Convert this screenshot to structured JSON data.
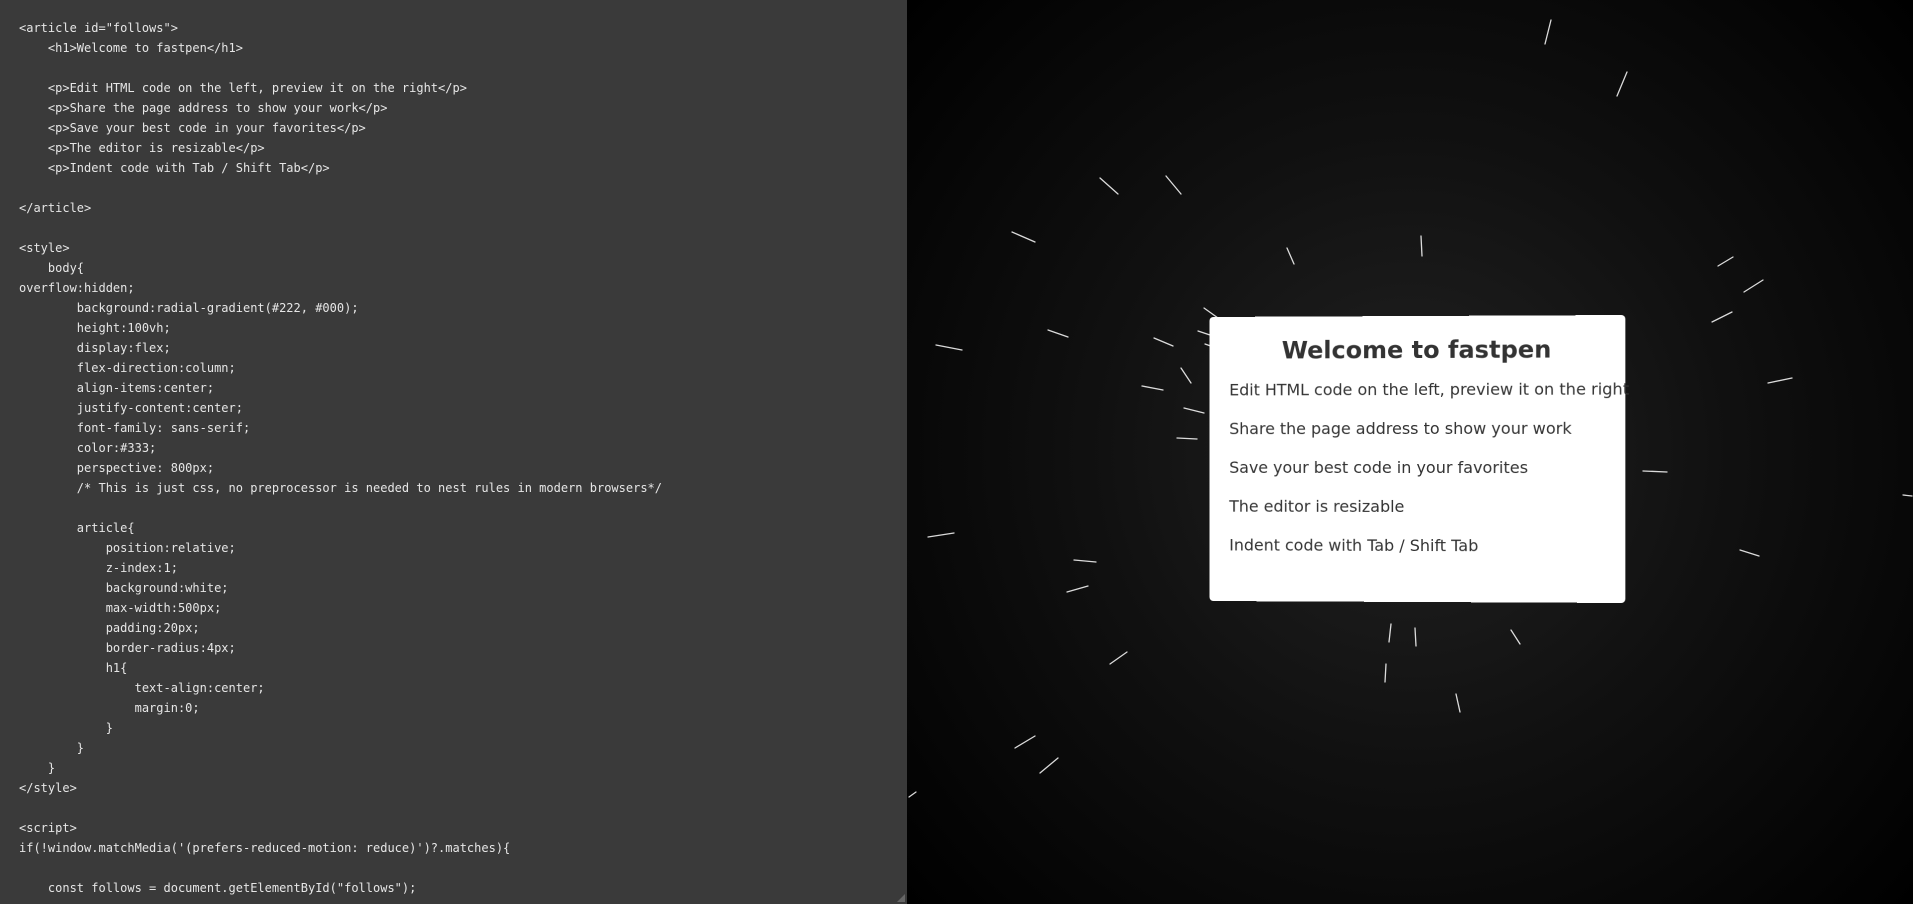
{
  "editor": {
    "code_lines": [
      "<article id=\"follows\">",
      "    <h1>Welcome to fastpen</h1>",
      "",
      "    <p>Edit HTML code on the left, preview it on the right</p>",
      "    <p>Share the page address to show your work</p>",
      "    <p>Save your best code in your favorites</p>",
      "    <p>The editor is resizable</p>",
      "    <p>Indent code with Tab / Shift Tab</p>",
      "",
      "</article>",
      "",
      "<style>",
      "    body{",
      "overflow:hidden;",
      "        background:radial-gradient(#222, #000);",
      "        height:100vh;",
      "        display:flex;",
      "        flex-direction:column;",
      "        align-items:center;",
      "        justify-content:center;",
      "        font-family: sans-serif;",
      "        color:#333;",
      "        perspective: 800px;",
      "        /* This is just css, no preprocessor is needed to nest rules in modern browsers*/",
      "",
      "        article{",
      "            position:relative;",
      "            z-index:1;",
      "            background:white;",
      "            max-width:500px;",
      "            padding:20px;",
      "            border-radius:4px;",
      "            h1{",
      "                text-align:center;",
      "                margin:0;",
      "            }",
      "        }",
      "    }",
      "</style>",
      "",
      "<script>",
      "if(!window.matchMedia('(prefers-reduced-motion: reduce)')?.matches){",
      "",
      "    const follows = document.getElementById(\"follows\");"
    ]
  },
  "preview": {
    "title": "Welcome to fastpen",
    "paragraphs": [
      "Edit HTML code on the left, preview it on the right",
      "Share the page address to show your work",
      "Save your best code in your favorites",
      "The editor is resizable",
      "Indent code with Tab / Shift Tab"
    ]
  },
  "colors": {
    "editor_bg": "#3a3a3a",
    "editor_text": "#e6e6e6",
    "card_bg": "#ffffff",
    "card_text": "#333333",
    "star": "#ffffff"
  },
  "icons": {
    "resize": "resize-handle-icon"
  }
}
